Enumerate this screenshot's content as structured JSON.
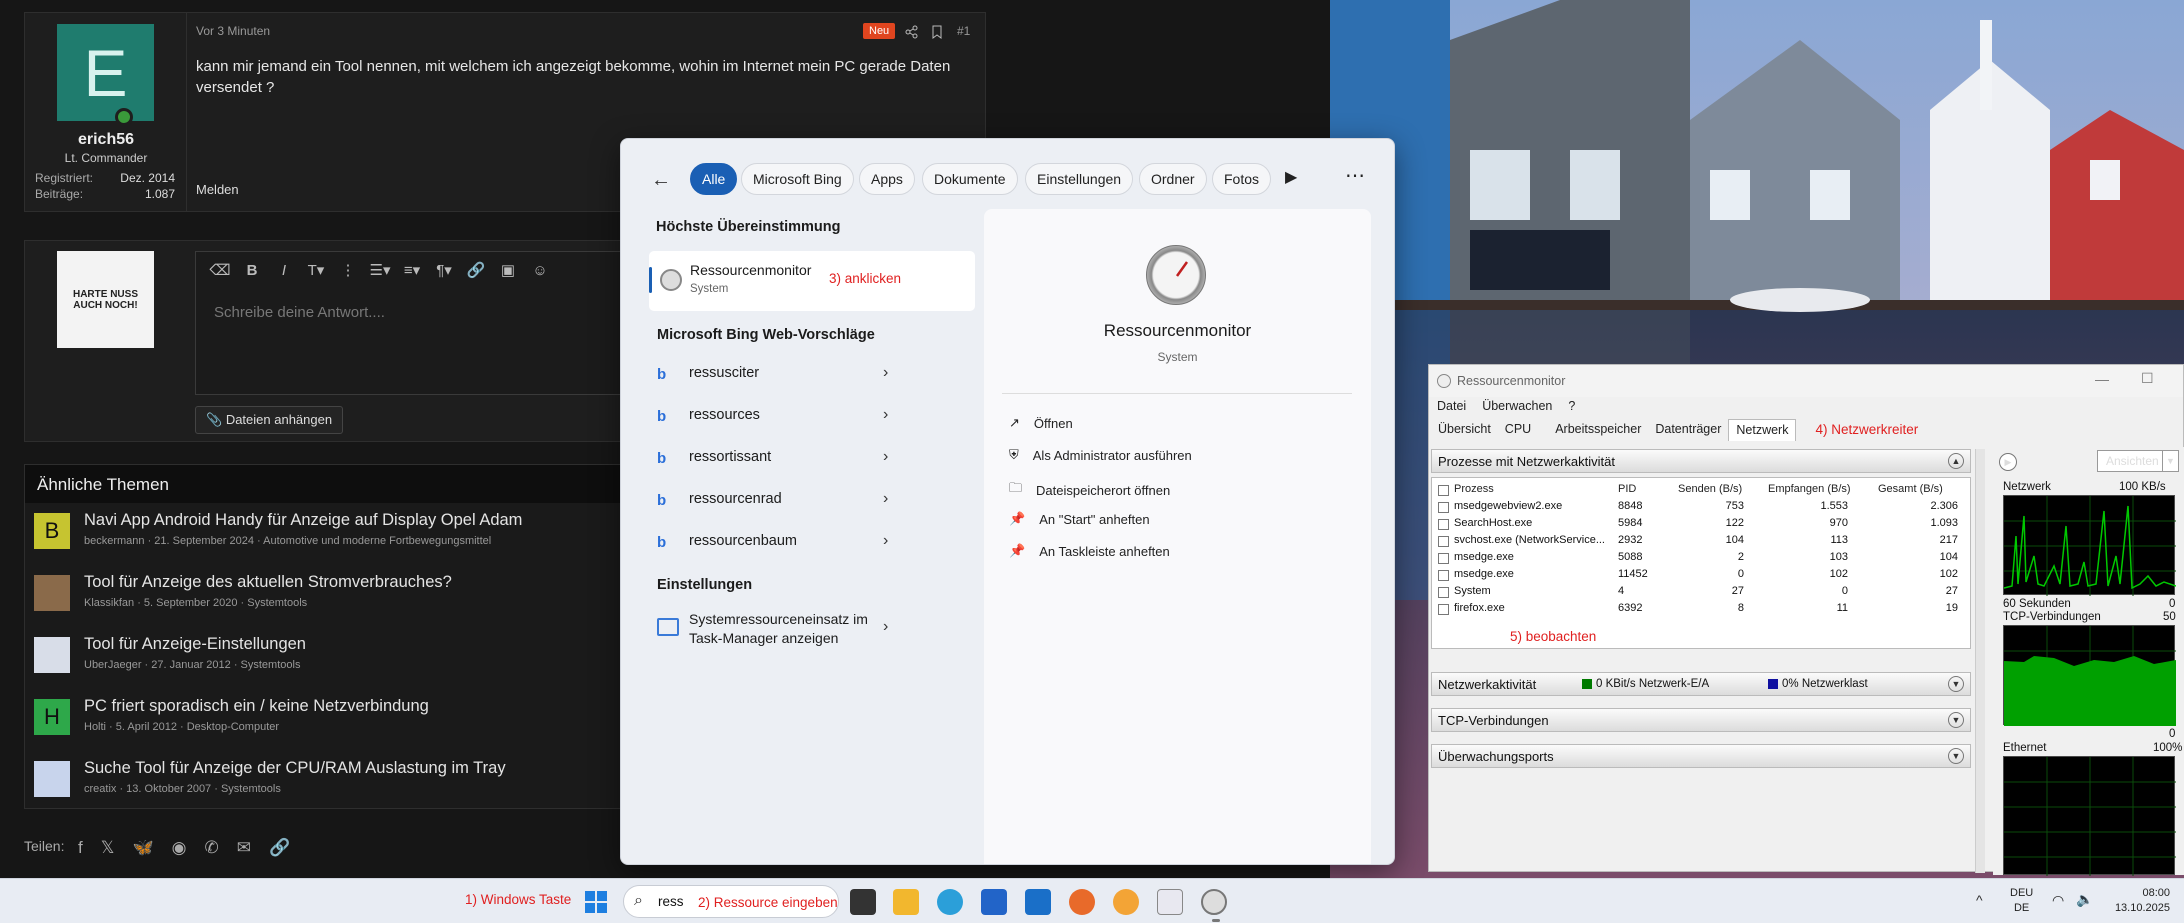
{
  "post": {
    "time": "Vor 3 Minuten",
    "badge_new": "Neu",
    "post_number": "#1",
    "avatar_letter": "E",
    "username": "erich56",
    "rank": "Lt. Commander",
    "registered_label": "Registriert:",
    "registered_value": "Dez. 2014",
    "posts_label": "Beiträge:",
    "posts_value": "1.087",
    "text": "kann mir jemand ein Tool nennen, mit welchem ich angezeigt bekomme, wohin im Internet mein PC gerade Daten versendet ?",
    "report": "Melden"
  },
  "reply": {
    "avatar_text": "HARTE NUSS AUCH NOCH!",
    "placeholder": "Schreibe deine Antwort....",
    "attach": "Dateien anhängen"
  },
  "similar": {
    "heading": "Ähnliche Themen",
    "items": [
      {
        "avatar": "B",
        "title": "Navi App Android Handy für Anzeige auf Display Opel Adam",
        "meta": "beckermann · 21. September 2024 · Automotive und moderne Fortbewegungsmittel"
      },
      {
        "avatar": "",
        "title": "Tool für Anzeige des aktuellen Stromverbrauches?",
        "meta": "Klassikfan · 5. September 2020 · Systemtools"
      },
      {
        "avatar": "",
        "title": "Tool für Anzeige-Einstellungen",
        "meta": "UberJaeger · 27. Januar 2012 · Systemtools"
      },
      {
        "avatar": "H",
        "title": "PC friert sporadisch ein / keine Netzverbindung",
        "meta": "Holti · 5. April 2012 · Desktop-Computer"
      },
      {
        "avatar": "",
        "title": "Suche Tool für Anzeige der CPU/RAM Auslastung im Tray",
        "meta": "creatix · 13. Oktober 2007 · Systemtools"
      }
    ]
  },
  "share_label": "Teilen:",
  "search": {
    "tabs": [
      "Alle",
      "Microsoft Bing",
      "Apps",
      "Dokumente",
      "Einstellungen",
      "Ordner",
      "Fotos"
    ],
    "best_match_heading": "Höchste Übereinstimmung",
    "best_match_title": "Ressourcenmonitor",
    "best_match_sub": "System",
    "annotation_click": "3) anklicken",
    "bing_heading": "Microsoft Bing Web-Vorschläge",
    "bing_items": [
      "ressusciter",
      "ressources",
      "ressortissant",
      "ressourcenrad",
      "ressourcenbaum"
    ],
    "settings_heading": "Einstellungen",
    "settings_item": "Systemressourceneinsatz im Task-Manager anzeigen",
    "detail_title": "Ressourcenmonitor",
    "detail_sub": "System",
    "actions": [
      "Öffnen",
      "Als Administrator ausführen",
      "Dateispeicherort öffnen",
      "An \"Start\" anheften",
      "An Taskleiste anheften"
    ]
  },
  "resmon": {
    "title": "Ressourcenmonitor",
    "menu": [
      "Datei",
      "Überwachen",
      "?"
    ],
    "tabs": [
      "Übersicht",
      "CPU",
      "Arbeitsspeicher",
      "Datenträger",
      "Netzwerk"
    ],
    "annotation_tab": "4) Netzwerkreiter",
    "proc_section": "Prozesse mit Netzwerkaktivität",
    "columns": [
      "Prozess",
      "PID",
      "Senden (B/s)",
      "Empfangen (B/s)",
      "Gesamt (B/s)"
    ],
    "rows": [
      [
        "msedgewebview2.exe",
        "8848",
        "753",
        "1.553",
        "2.306"
      ],
      [
        "SearchHost.exe",
        "5984",
        "122",
        "970",
        "1.093"
      ],
      [
        "svchost.exe (NetworkService...",
        "2932",
        "104",
        "113",
        "217"
      ],
      [
        "msedge.exe",
        "5088",
        "2",
        "103",
        "104"
      ],
      [
        "msedge.exe",
        "11452",
        "0",
        "102",
        "102"
      ],
      [
        "System",
        "4",
        "27",
        "0",
        "27"
      ],
      [
        "firefox.exe",
        "6392",
        "8",
        "11",
        "19"
      ]
    ],
    "annotation_observe": "5) beobachten",
    "net_section": "Netzwerkaktivität",
    "net_io": "0 KBit/s Netzwerk-E/A",
    "net_load": "0% Netzwerklast",
    "tcp_section": "TCP-Verbindungen",
    "ports_section": "Überwachungsports",
    "views_button": "Ansichten",
    "graph_network": "Netzwerk",
    "graph_network_max": "100 KB/s",
    "graph_60s": "60 Sekunden",
    "graph_zero_1": "0",
    "graph_tcp": "TCP-Verbindungen",
    "graph_tcp_max": "50",
    "graph_zero_2": "0",
    "graph_ethernet": "Ethernet",
    "graph_ethernet_max": "100%"
  },
  "taskbar": {
    "annotation_winkey": "1) Windows Taste",
    "search_text": "ress",
    "annotation_enter": "2) Ressource eingeben",
    "lang_top": "DEU",
    "lang_bottom": "DE",
    "time": "08:00",
    "date": "13.10.2025"
  },
  "colors": {
    "accent": "#1a5fb4",
    "annotation": "#e02020",
    "badge_new": "#e0451f",
    "graph_green": "#00c800"
  }
}
